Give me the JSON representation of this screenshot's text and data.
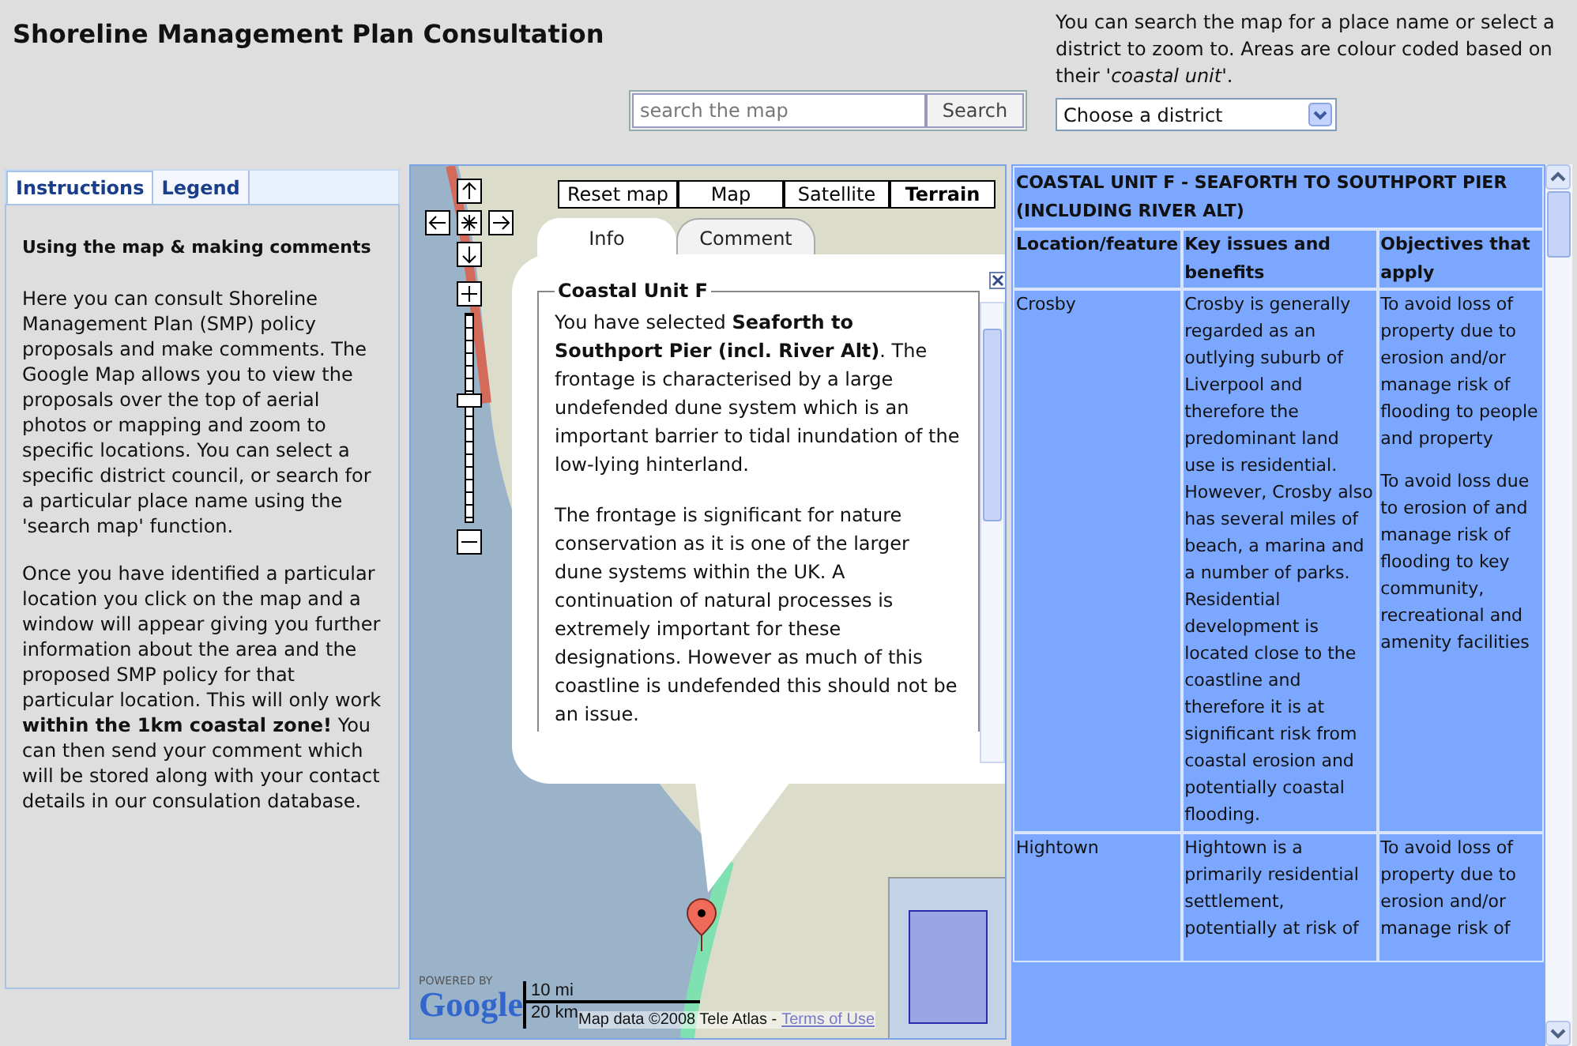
{
  "page_title": "Shoreline Management Plan Consultation",
  "search": {
    "placeholder": "search the map",
    "button": "Search"
  },
  "help_text": "You can search the map for a place name or select a district to zoom to. Areas are colour coded based on their *'coastal unit'*.",
  "district_select": {
    "value": "Choose a district"
  },
  "side_tabs": [
    {
      "label": "Instructions",
      "selected": true
    },
    {
      "label": "Legend",
      "selected": false
    }
  ],
  "instructions": {
    "heading": "Using the map & making comments",
    "paragraphs": [
      "Here you can consult Shoreline Management Plan (SMP) policy proposals and make comments. The Google Map allows you to view the proposals over the top of aerial photos or mapping and zoom to specific locations. You can select a specific district council, or search for a particular place name using the 'search map' function.",
      "Once you have identified a particular location you click on the map and a window will appear giving you further information about the area and the proposed SMP policy for that particular location. This will only work **within the 1km coastal zone!** You can then send your comment which will be stored along with your contact details in our consulation database."
    ]
  },
  "map": {
    "buttons": [
      {
        "label": "Reset map",
        "selected": false
      },
      {
        "label": "Map",
        "selected": false
      },
      {
        "label": "Satellite",
        "selected": false
      },
      {
        "label": "Terrain",
        "selected": true
      }
    ],
    "zoom_slider": {
      "level": 0.59
    },
    "info_window": {
      "tabs": [
        {
          "label": "Info",
          "selected": true
        },
        {
          "label": "Comment",
          "selected": false
        }
      ],
      "legend": "Coastal Unit F",
      "paragraphs": [
        "You have selected **Seaforth to Southport Pier (incl. River Alt)**. The frontage is characterised by a large undefended dune system which is an important barrier to tidal inundation of the low-lying hinterland.",
        "The frontage is significant for nature conservation as it is one of the larger dune systems within the UK. A continuation of natural processes is extremely important for these designations. However as much of this coastline is undefended this should not be an issue."
      ]
    },
    "powered_by": "POWERED BY",
    "logo": "Google",
    "scale": {
      "miles": "10 mi",
      "km": "20 km"
    },
    "attribution": "Map data ©2008 Tele Atlas -",
    "terms_link": "Terms of Use"
  },
  "table": {
    "title": "COASTAL UNIT F - SEAFORTH TO SOUTHPORT PIER (INCLUDING RIVER ALT)",
    "columns": [
      "Location/feature",
      "Key issues and benefits",
      "Objectives that apply"
    ],
    "rows": [
      {
        "location": "Crosby",
        "issues": "Crosby is generally regarded as an outlying suburb of Liverpool and therefore the predominant land use is residential. However, Crosby also has several miles of beach, a marina and a number of parks. Residential development is located close to the coastline and therefore it is at significant risk from coastal erosion and potentially coastal flooding.",
        "objectives": [
          "To avoid loss of property due to erosion and/or manage risk of flooding to people and property",
          "To avoid loss due to erosion of and manage risk of flooding to key community, recreational and amenity facilities"
        ]
      },
      {
        "location": "Hightown",
        "issues": "Hightown is a primarily residential settlement, potentially at risk of",
        "objectives": [
          "To avoid loss of property due to erosion and/or manage risk of"
        ]
      }
    ]
  }
}
